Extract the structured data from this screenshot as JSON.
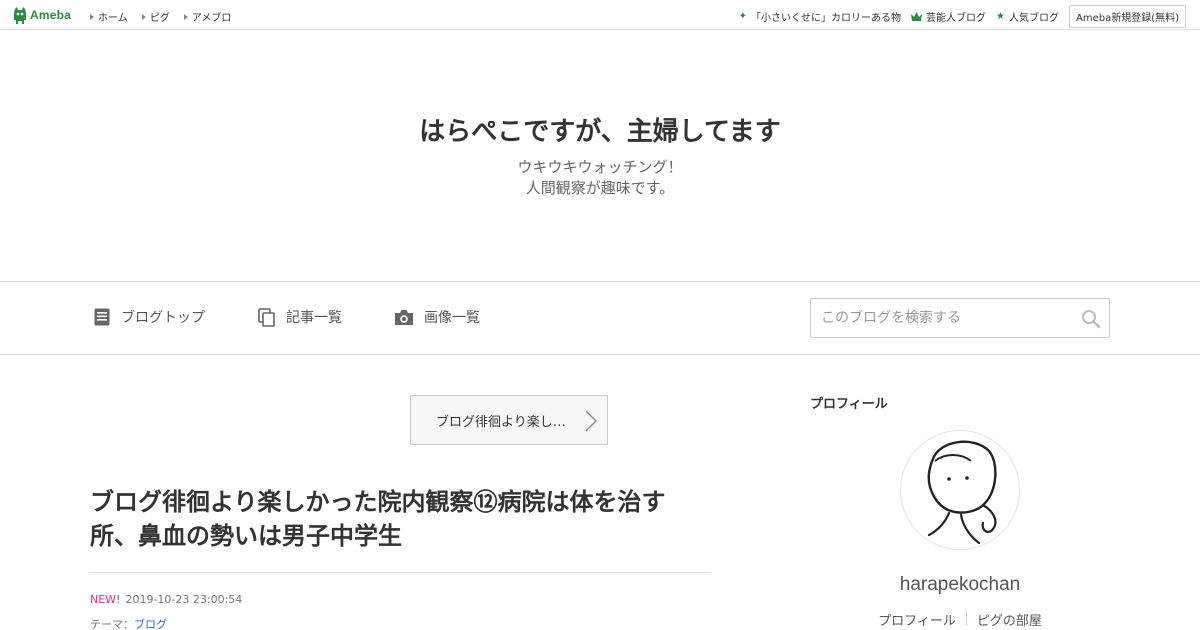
{
  "topbar": {
    "logo_text": "Ameba",
    "nav": [
      "ホーム",
      "ピグ",
      "アメブロ"
    ],
    "right_links": [
      {
        "icon": "sparkle-icon",
        "label": "「小さいくせに」カロリーある物"
      },
      {
        "icon": "crown-icon",
        "label": "芸能人ブログ"
      },
      {
        "icon": "star-icon",
        "label": "人気ブログ"
      }
    ],
    "signup_label": "Ameba新規登録(無料)"
  },
  "header": {
    "title": "はらぺこですが、主婦してます",
    "desc_line1": "ウキウキウォッチング！",
    "desc_line2": "人間観察が趣味です。"
  },
  "nav": {
    "items": [
      {
        "icon": "document-icon",
        "label": "ブログトップ"
      },
      {
        "icon": "copy-icon",
        "label": "記事一覧"
      },
      {
        "icon": "camera-icon",
        "label": "画像一覧"
      }
    ],
    "search_placeholder": "このブログを検索する"
  },
  "main": {
    "prev_button": "ブログ徘徊より楽し…",
    "entry_title": "ブログ徘徊より楽しかった院内観察⑫病院は体を治す所、鼻血の勢いは男子中学生",
    "new_badge": "NEW!",
    "timestamp": "2019-10-23 23:00:54",
    "theme_label": "テーマ：",
    "theme_link": "ブログ"
  },
  "sidebar": {
    "heading": "プロフィール",
    "username": "harapekochan",
    "links": [
      "プロフィール",
      "ピグの部屋"
    ]
  },
  "colors": {
    "brand_green": "#2d8c3c",
    "new_pink": "#e62e8b",
    "link_blue": "#2a6fb0"
  }
}
